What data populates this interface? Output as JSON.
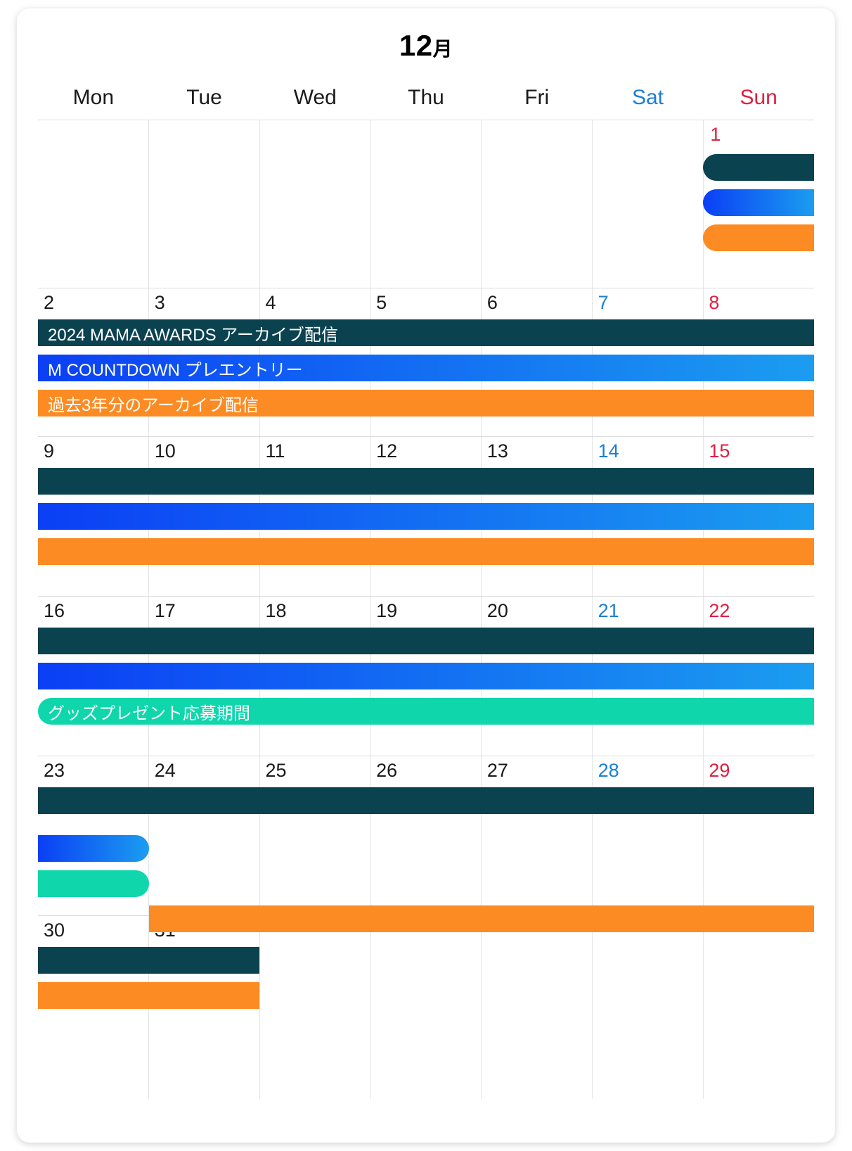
{
  "header": {
    "month_number": "12",
    "month_unit": "月",
    "title_full": "12月"
  },
  "weekdays": [
    {
      "label": "Mon",
      "type": "weekday"
    },
    {
      "label": "Tue",
      "type": "weekday"
    },
    {
      "label": "Wed",
      "type": "weekday"
    },
    {
      "label": "Thu",
      "type": "weekday"
    },
    {
      "label": "Fri",
      "type": "weekday"
    },
    {
      "label": "Sat",
      "type": "saturday"
    },
    {
      "label": "Sun",
      "type": "sunday"
    }
  ],
  "colors": {
    "saturday": "#1a7fd4",
    "sunday": "#e01f41",
    "archive_teal": "#0b4250",
    "countdown_blue_start": "#0b3ff5",
    "countdown_blue_end": "#1b9df0",
    "past_archive_orange": "#fb8b22",
    "goods_green": "#0fd6ab"
  },
  "weeks": [
    {
      "days": [
        "",
        "",
        "",
        "",
        "",
        "",
        "1"
      ],
      "bars": [
        {
          "label": "",
          "color": "teal",
          "start": 6,
          "span": 1,
          "round_left": true,
          "round_right": false
        },
        {
          "label": "",
          "color": "blue",
          "start": 6,
          "span": 1,
          "round_left": true,
          "round_right": false
        },
        {
          "label": "",
          "color": "orange",
          "start": 6,
          "span": 1,
          "round_left": true,
          "round_right": false
        }
      ]
    },
    {
      "days": [
        "2",
        "3",
        "4",
        "5",
        "6",
        "7",
        "8"
      ],
      "bars": [
        {
          "label": "2024 MAMA  AWARDS アーカイブ配信",
          "color": "teal",
          "start": 0,
          "span": 7,
          "round_left": false,
          "round_right": false
        },
        {
          "label": "M COUNTDOWN プレエントリー",
          "color": "blue",
          "start": 0,
          "span": 7,
          "round_left": false,
          "round_right": false
        },
        {
          "label": "過去3年分のアーカイブ配信",
          "color": "orange",
          "start": 0,
          "span": 7,
          "round_left": false,
          "round_right": false
        }
      ]
    },
    {
      "days": [
        "9",
        "10",
        "11",
        "12",
        "13",
        "14",
        "15"
      ],
      "bars": [
        {
          "label": "",
          "color": "teal",
          "start": 0,
          "span": 7,
          "round_left": false,
          "round_right": false
        },
        {
          "label": "",
          "color": "blue",
          "start": 0,
          "span": 7,
          "round_left": false,
          "round_right": false
        },
        {
          "label": "",
          "color": "orange",
          "start": 0,
          "span": 7,
          "round_left": false,
          "round_right": false
        }
      ]
    },
    {
      "days": [
        "16",
        "17",
        "18",
        "19",
        "20",
        "21",
        "22"
      ],
      "bars": [
        {
          "label": "",
          "color": "teal",
          "start": 0,
          "span": 7,
          "round_left": false,
          "round_right": false
        },
        {
          "label": "",
          "color": "blue",
          "start": 0,
          "span": 7,
          "round_left": false,
          "round_right": false
        },
        {
          "label": "グッズプレゼント応募期間",
          "color": "green",
          "start": 0,
          "span": 7,
          "round_left": true,
          "round_right": false
        }
      ]
    },
    {
      "days": [
        "23",
        "24",
        "25",
        "26",
        "27",
        "28",
        "29"
      ],
      "bars": [
        {
          "label": "",
          "color": "teal",
          "start": 0,
          "span": 7,
          "round_left": false,
          "round_right": false
        },
        {
          "label": "",
          "color": "blue",
          "start": 0,
          "span": 1,
          "round_left": false,
          "round_right": true
        },
        {
          "label": "",
          "color": "green",
          "start": 0,
          "span": 1,
          "round_left": false,
          "round_right": true
        },
        {
          "label": "",
          "color": "orange",
          "start": 1,
          "span": 6,
          "round_left": false,
          "round_right": false
        }
      ]
    },
    {
      "days": [
        "30",
        "31",
        "",
        "",
        "",
        "",
        ""
      ],
      "bars": [
        {
          "label": "",
          "color": "teal",
          "start": 0,
          "span": 2,
          "round_left": false,
          "round_right": false
        },
        {
          "label": "",
          "color": "orange",
          "start": 0,
          "span": 2,
          "round_left": false,
          "round_right": false
        }
      ]
    }
  ]
}
